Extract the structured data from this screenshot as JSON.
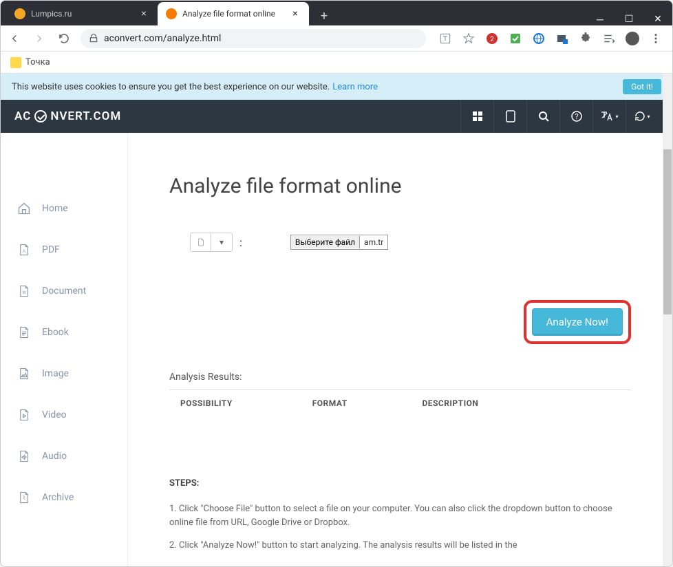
{
  "window": {
    "tabs": [
      {
        "title": "Lumpics.ru",
        "favicon": "#f5a623",
        "active": false
      },
      {
        "title": "Analyze file format online",
        "favicon": "#f57c00",
        "active": true
      }
    ]
  },
  "address": {
    "url": "aconvert.com/analyze.html"
  },
  "bookmarks": {
    "item1": "Точка"
  },
  "cookie": {
    "text": "This website uses cookies to ensure you get the best experience on our website.",
    "link": "Learn more",
    "button": "Got it!"
  },
  "header": {
    "logo_prefix": "AC",
    "logo_suffix": "NVERT.COM"
  },
  "sidebar": {
    "items": [
      {
        "label": "Home"
      },
      {
        "label": "PDF"
      },
      {
        "label": "Document"
      },
      {
        "label": "Ebook"
      },
      {
        "label": "Image"
      },
      {
        "label": "Video"
      },
      {
        "label": "Audio"
      },
      {
        "label": "Archive"
      }
    ]
  },
  "page": {
    "title": "Analyze file format online",
    "choose_label": "Выберите файл",
    "chosen_file": "am.tr",
    "analyze_button": "Analyze Now!",
    "results_label": "Analysis Results:",
    "columns": {
      "c1": "POSSIBILITY",
      "c2": "FORMAT",
      "c3": "DESCRIPTION"
    },
    "steps_label": "STEPS:",
    "step1": "1. Click \"Choose File\" button to select a file on your computer. You can also click the dropdown button to choose online file from URL, Google Drive or Dropbox.",
    "step2": "2. Click \"Analyze Now!\" button to start analyzing. The analysis results will be listed in the"
  }
}
